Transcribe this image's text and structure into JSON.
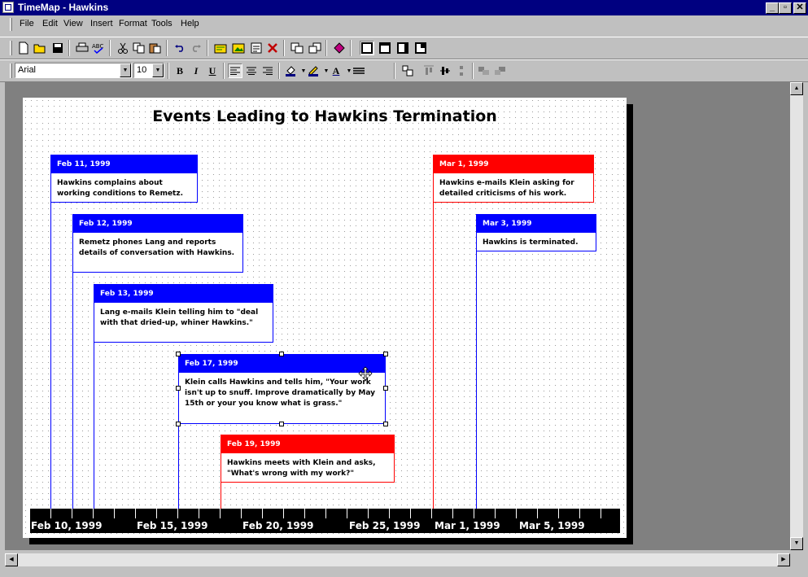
{
  "window": {
    "title": "TimeMap - Hawkins"
  },
  "menu": [
    "File",
    "Edit",
    "View",
    "Insert",
    "Format",
    "Tools",
    "Help"
  ],
  "window_controls": {
    "minimize": "_",
    "maximize": "▫",
    "close": "✕"
  },
  "format_toolbar": {
    "font": "Arial",
    "size": "10",
    "bold": "B",
    "italic": "I",
    "underline": "U",
    "font_color_glyph": "A"
  },
  "icons": {
    "new": "new-file-icon",
    "open": "open-folder-icon",
    "save": "save-disk-icon",
    "print": "printer-icon",
    "spell": "spellcheck-icon",
    "cut": "scissors-icon",
    "copy": "copy-icon",
    "paste": "paste-icon",
    "undo": "undo-icon",
    "redo": "redo-icon",
    "delete": "delete-x-icon"
  },
  "document": {
    "title": "Events Leading to Hawkins Termination",
    "events": [
      {
        "date": "Feb 11, 1999",
        "text": "Hawkins complains about working conditions to Remetz.",
        "color": "#0000ff"
      },
      {
        "date": "Feb 12, 1999",
        "text": "Remetz phones Lang and reports details of conversation with Hawkins.",
        "color": "#0000ff"
      },
      {
        "date": "Feb 13, 1999",
        "text": "Lang e-mails Klein telling him to \"deal with that dried-up, whiner Hawkins.\"",
        "color": "#0000ff"
      },
      {
        "date": "Feb 17, 1999",
        "text": "Klein calls Hawkins and tells him, \"Your work isn't up to snuff.  Improve dramatically by May 15th or your you know what is grass.\"",
        "color": "#0000ff"
      },
      {
        "date": "Feb 19, 1999",
        "text": "Hawkins meets with Klein and asks, \"What's wrong with my work?\"",
        "color": "#ff0000"
      },
      {
        "date": "Mar 1, 1999",
        "text": "Hawkins e-mails Klein asking for detailed criticisms of his work.",
        "color": "#ff0000"
      },
      {
        "date": "Mar 3, 1999",
        "text": "Hawkins is terminated.",
        "color": "#0000ff"
      }
    ],
    "axis_labels": [
      "Feb 10, 1999",
      "Feb 15, 1999",
      "Feb 20, 1999",
      "Feb 25, 1999",
      "Mar 1, 1999",
      "Mar 5, 1999"
    ]
  }
}
